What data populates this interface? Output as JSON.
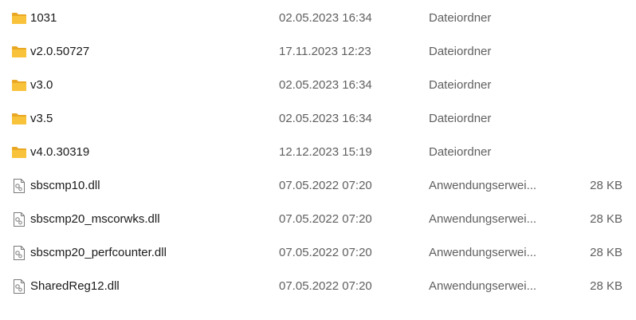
{
  "file_list": {
    "rows": [
      {
        "name": "1031",
        "modified": "02.05.2023 16:34",
        "type": "Dateiordner",
        "size": "",
        "icon": "folder-icon"
      },
      {
        "name": "v2.0.50727",
        "modified": "17.11.2023 12:23",
        "type": "Dateiordner",
        "size": "",
        "icon": "folder-icon"
      },
      {
        "name": "v3.0",
        "modified": "02.05.2023 16:34",
        "type": "Dateiordner",
        "size": "",
        "icon": "folder-icon"
      },
      {
        "name": "v3.5",
        "modified": "02.05.2023 16:34",
        "type": "Dateiordner",
        "size": "",
        "icon": "folder-icon"
      },
      {
        "name": "v4.0.30319",
        "modified": "12.12.2023 15:19",
        "type": "Dateiordner",
        "size": "",
        "icon": "folder-icon"
      },
      {
        "name": "sbscmp10.dll",
        "modified": "07.05.2022 07:20",
        "type": "Anwendungserwei...",
        "size": "28 KB",
        "icon": "dll-file-icon"
      },
      {
        "name": "sbscmp20_mscorwks.dll",
        "modified": "07.05.2022 07:20",
        "type": "Anwendungserwei...",
        "size": "28 KB",
        "icon": "dll-file-icon"
      },
      {
        "name": "sbscmp20_perfcounter.dll",
        "modified": "07.05.2022 07:20",
        "type": "Anwendungserwei...",
        "size": "28 KB",
        "icon": "dll-file-icon"
      },
      {
        "name": "SharedReg12.dll",
        "modified": "07.05.2022 07:20",
        "type": "Anwendungserwei...",
        "size": "28 KB",
        "icon": "dll-file-icon"
      }
    ]
  },
  "colors": {
    "folder_fill": "#f8c23a",
    "folder_tab": "#e9a824",
    "file_outline": "#7a7a7a",
    "secondary_text": "#5f5f5f",
    "primary_text": "#1a1a1a"
  }
}
